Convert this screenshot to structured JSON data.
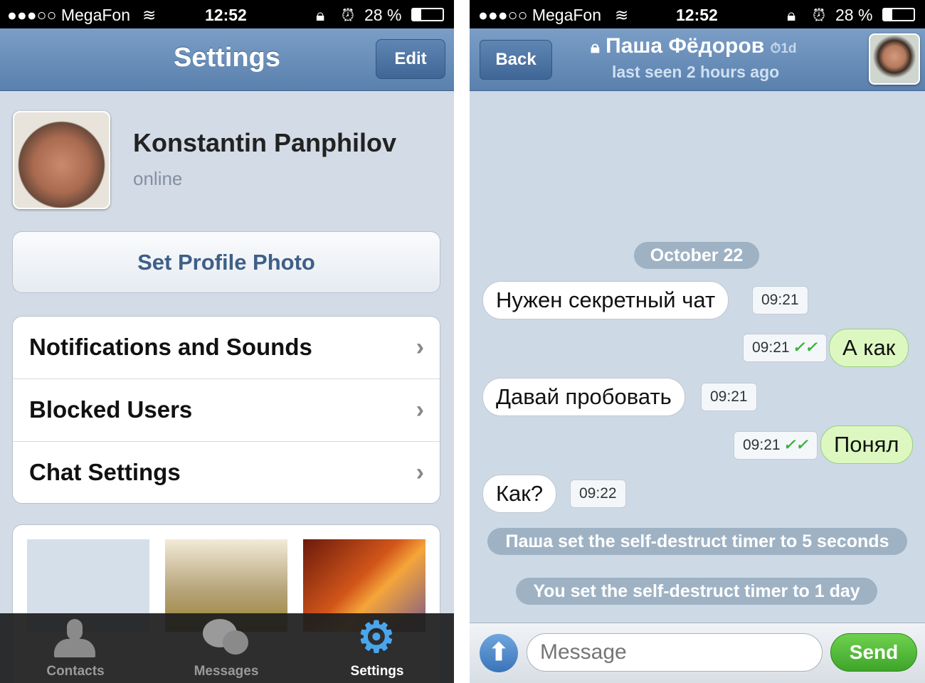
{
  "status": {
    "carrier": "●●●○○ MegaFon",
    "time": "12:52",
    "battery": "28 %"
  },
  "settings": {
    "title": "Settings",
    "edit": "Edit",
    "profile": {
      "name": "Konstantin Panphilov",
      "status": "online"
    },
    "set_photo": "Set Profile Photo",
    "items": [
      {
        "label": "Notifications and Sounds"
      },
      {
        "label": "Blocked Users"
      },
      {
        "label": "Chat Settings"
      }
    ],
    "tabs": [
      {
        "label": "Contacts",
        "icon": "person-icon"
      },
      {
        "label": "Messages",
        "icon": "chat-bubbles-icon"
      },
      {
        "label": "Settings",
        "icon": "gear-icon",
        "active": true
      }
    ]
  },
  "chat": {
    "back": "Back",
    "name": "Паша Фёдоров",
    "timer": "1d",
    "last_seen": "last seen 2 hours ago",
    "date": "October 22",
    "messages": [
      {
        "text": "Нужен секретный чат",
        "time": "09:21",
        "dir": "in"
      },
      {
        "text": "А как",
        "time": "09:21",
        "dir": "out",
        "read": true
      },
      {
        "text": "Давай пробовать",
        "time": "09:21",
        "dir": "in"
      },
      {
        "text": "Понял",
        "time": "09:21",
        "dir": "out",
        "read": true
      },
      {
        "text": "Как?",
        "time": "09:22",
        "dir": "in"
      }
    ],
    "service": [
      "Паша set the self-destruct timer to 5 seconds",
      "You set the self-destruct timer to 1 day"
    ],
    "input_placeholder": "Message",
    "send": "Send"
  },
  "colors": {
    "accent": "#5a80ad",
    "send": "#4cb932",
    "bubble_out": "#dcf8c0"
  }
}
